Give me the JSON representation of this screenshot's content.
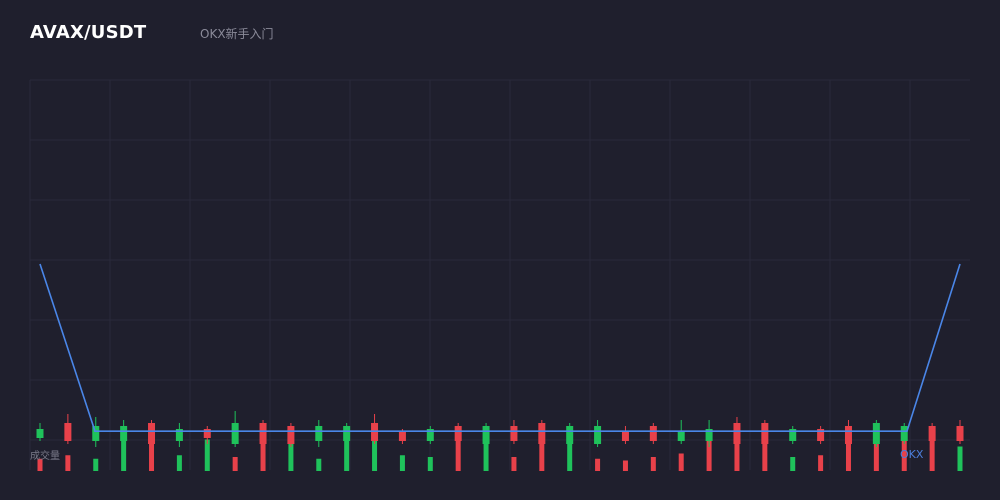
{
  "header": {
    "pair": "AVAX/USDT",
    "tag": "OKX新手入门"
  },
  "volume_label": "成交量",
  "watermark": "OKX",
  "colors": {
    "background": "#1f1f2d",
    "grid": "#2a2a3a",
    "up": "#1fc25b",
    "down": "#e8414a",
    "line": "#4a86e8"
  },
  "chart_data": {
    "type": "candlestick",
    "grid": true,
    "line_series": [
      100,
      5,
      5,
      5,
      5,
      5,
      5,
      5,
      5,
      5,
      5,
      5,
      5,
      5,
      5,
      5,
      5,
      5,
      5,
      5,
      5,
      5,
      5,
      5,
      5,
      5,
      5,
      5,
      5,
      5,
      5,
      5,
      5,
      5,
      100
    ],
    "candles": [
      {
        "o": 4,
        "c": 7,
        "h": 9,
        "l": 3
      },
      {
        "o": 9,
        "c": 3,
        "h": 12,
        "l": 2
      },
      {
        "o": 3,
        "c": 8,
        "h": 11,
        "l": 1
      },
      {
        "o": 3,
        "c": 8,
        "h": 10,
        "l": 1
      },
      {
        "o": 9,
        "c": 2,
        "h": 10,
        "l": 1
      },
      {
        "o": 3,
        "c": 7,
        "h": 9,
        "l": 1
      },
      {
        "o": 7,
        "c": 4,
        "h": 8,
        "l": 2
      },
      {
        "o": 2,
        "c": 9,
        "h": 13,
        "l": 1
      },
      {
        "o": 9,
        "c": 2,
        "h": 10,
        "l": 1
      },
      {
        "o": 8,
        "c": 2,
        "h": 9,
        "l": 1
      },
      {
        "o": 3,
        "c": 8,
        "h": 10,
        "l": 1
      },
      {
        "o": 3,
        "c": 8,
        "h": 9,
        "l": 2
      },
      {
        "o": 9,
        "c": 3,
        "h": 12,
        "l": 2
      },
      {
        "o": 6,
        "c": 3,
        "h": 7,
        "l": 2
      },
      {
        "o": 3,
        "c": 7,
        "h": 8,
        "l": 2
      },
      {
        "o": 8,
        "c": 3,
        "h": 9,
        "l": 2
      },
      {
        "o": 2,
        "c": 8,
        "h": 9,
        "l": 1
      },
      {
        "o": 8,
        "c": 3,
        "h": 10,
        "l": 2
      },
      {
        "o": 9,
        "c": 2,
        "h": 10,
        "l": 1
      },
      {
        "o": 2,
        "c": 8,
        "h": 9,
        "l": 1
      },
      {
        "o": 2,
        "c": 8,
        "h": 10,
        "l": 1
      },
      {
        "o": 6,
        "c": 3,
        "h": 8,
        "l": 2
      },
      {
        "o": 8,
        "c": 3,
        "h": 9,
        "l": 2
      },
      {
        "o": 3,
        "c": 6,
        "h": 10,
        "l": 2
      },
      {
        "o": 3,
        "c": 7,
        "h": 10,
        "l": 1
      },
      {
        "o": 9,
        "c": 2,
        "h": 11,
        "l": 1
      },
      {
        "o": 9,
        "c": 2,
        "h": 10,
        "l": 1
      },
      {
        "o": 3,
        "c": 7,
        "h": 8,
        "l": 2
      },
      {
        "o": 7,
        "c": 3,
        "h": 8,
        "l": 2
      },
      {
        "o": 8,
        "c": 2,
        "h": 10,
        "l": 1
      },
      {
        "o": 2,
        "c": 9,
        "h": 10,
        "l": 1
      },
      {
        "o": 3,
        "c": 8,
        "h": 9,
        "l": 2
      },
      {
        "o": 8,
        "c": 3,
        "h": 9,
        "l": 2
      },
      {
        "o": 8,
        "c": 3,
        "h": 10,
        "l": 2
      }
    ],
    "volumes": [
      {
        "v": 7,
        "d": "down"
      },
      {
        "v": 9,
        "d": "down"
      },
      {
        "v": 7,
        "d": "up"
      },
      {
        "v": 19,
        "d": "up"
      },
      {
        "v": 19,
        "d": "down"
      },
      {
        "v": 9,
        "d": "up"
      },
      {
        "v": 18,
        "d": "up"
      },
      {
        "v": 8,
        "d": "down"
      },
      {
        "v": 20,
        "d": "down"
      },
      {
        "v": 20,
        "d": "up"
      },
      {
        "v": 7,
        "d": "up"
      },
      {
        "v": 18,
        "d": "up"
      },
      {
        "v": 19,
        "d": "up"
      },
      {
        "v": 9,
        "d": "up"
      },
      {
        "v": 8,
        "d": "up"
      },
      {
        "v": 19,
        "d": "down"
      },
      {
        "v": 19,
        "d": "up"
      },
      {
        "v": 8,
        "d": "down"
      },
      {
        "v": 20,
        "d": "down"
      },
      {
        "v": 19,
        "d": "up"
      },
      {
        "v": 7,
        "d": "down"
      },
      {
        "v": 6,
        "d": "down"
      },
      {
        "v": 8,
        "d": "down"
      },
      {
        "v": 10,
        "d": "down"
      },
      {
        "v": 19,
        "d": "down"
      },
      {
        "v": 19,
        "d": "down"
      },
      {
        "v": 20,
        "d": "down"
      },
      {
        "v": 8,
        "d": "up"
      },
      {
        "v": 9,
        "d": "down"
      },
      {
        "v": 19,
        "d": "down"
      },
      {
        "v": 19,
        "d": "down"
      },
      {
        "v": 18,
        "d": "down"
      },
      {
        "v": 19,
        "d": "down"
      },
      {
        "v": 14,
        "d": "up"
      }
    ]
  }
}
